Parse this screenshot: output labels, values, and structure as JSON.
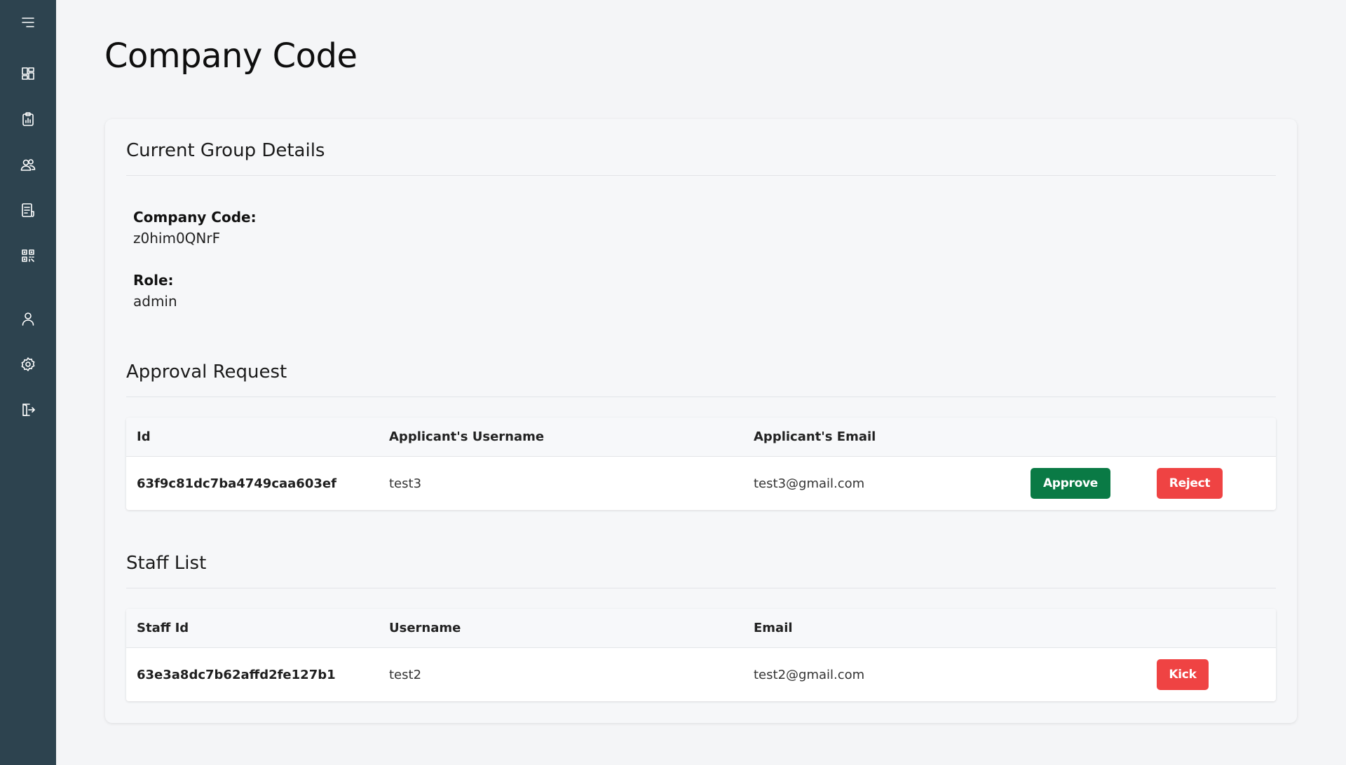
{
  "sidebar": {
    "items": [
      {
        "icon": "menu-icon"
      },
      {
        "icon": "dashboard-icon"
      },
      {
        "icon": "clipboard-chart-icon"
      },
      {
        "icon": "users-icon"
      },
      {
        "icon": "report-icon"
      },
      {
        "icon": "qr-code-icon"
      },
      {
        "icon": "user-icon"
      },
      {
        "icon": "settings-icon"
      },
      {
        "icon": "logout-icon"
      }
    ],
    "background": "#2d434f"
  },
  "page": {
    "title": "Company Code"
  },
  "group_details": {
    "title": "Current Group Details",
    "company_code_label": "Company Code:",
    "company_code_value": "z0him0QNrF",
    "role_label": "Role:",
    "role_value": "admin"
  },
  "approval": {
    "title": "Approval Request",
    "headers": {
      "id": "Id",
      "username": "Applicant's Username",
      "email": "Applicant's Email"
    },
    "rows": [
      {
        "id": "63f9c81dc7ba4749caa603ef",
        "username": "test3",
        "email": "test3@gmail.com",
        "approve_label": "Approve",
        "reject_label": "Reject"
      }
    ]
  },
  "staff": {
    "title": "Staff List",
    "headers": {
      "id": "Staff Id",
      "username": "Username",
      "email": "Email"
    },
    "rows": [
      {
        "id": "63e3a8dc7b62affd2fe127b1",
        "username": "test2",
        "email": "test2@gmail.com",
        "kick_label": "Kick"
      }
    ]
  },
  "colors": {
    "approve": "#0a7a45",
    "reject": "#ef4343",
    "kick": "#ef4343"
  }
}
